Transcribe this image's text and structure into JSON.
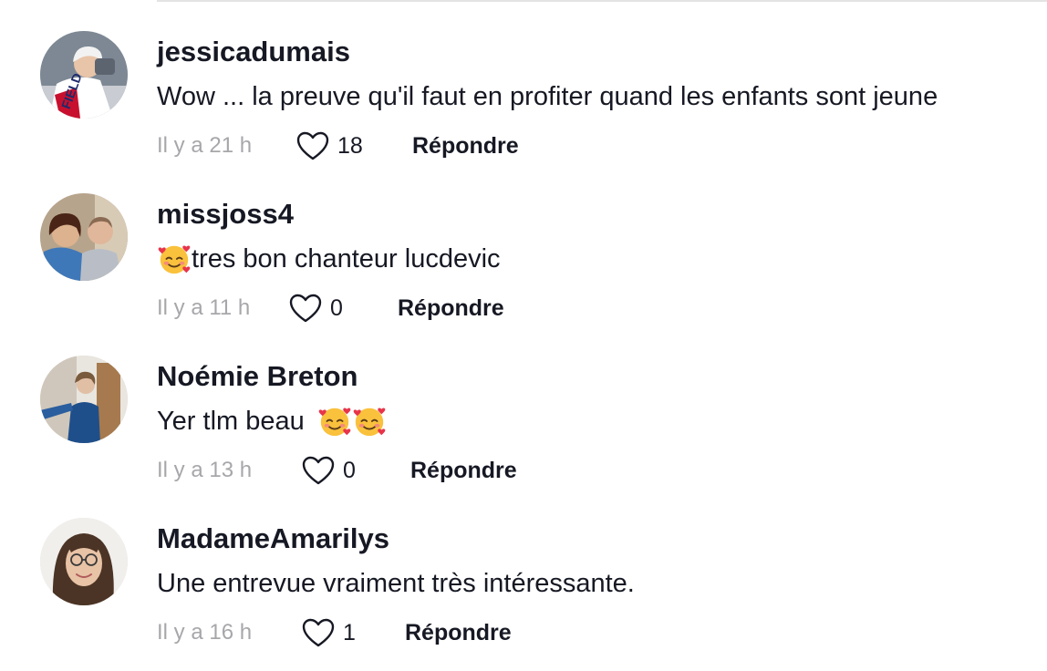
{
  "comments": [
    {
      "username": "jessicadumais",
      "text": "Wow ... la preuve qu'il faut en profiter quand les enfants sont jeune",
      "emoji_before": "",
      "emoji_after": "",
      "time": "Il y a 21 h",
      "likes": "18",
      "reply_label": "Répondre",
      "avatar_icon": "hockey-player-avatar"
    },
    {
      "username": "missjoss4",
      "text": "tres bon chanteur lucdevic",
      "emoji_before": "🥰",
      "emoji_after": "",
      "time": "Il y a 11 h",
      "likes": "0",
      "reply_label": "Répondre",
      "avatar_icon": "couple-avatar"
    },
    {
      "username": "Noémie Breton",
      "text": "Yer tlm beau ",
      "emoji_before": "",
      "emoji_after": "🥰🥰",
      "time": "Il y a 13 h",
      "likes": "0",
      "reply_label": "Répondre",
      "avatar_icon": "person-avatar"
    },
    {
      "username": "MadameAmarilys",
      "text": "Une entrevue vraiment très intéressante.",
      "emoji_before": "",
      "emoji_after": "",
      "time": "Il y a 16 h",
      "likes": "1",
      "reply_label": "Répondre",
      "avatar_icon": "woman-glasses-avatar"
    }
  ],
  "colors": {
    "primary_text": "#161823",
    "secondary_text": "#a7a7ab",
    "divider": "#e3e3e4"
  }
}
